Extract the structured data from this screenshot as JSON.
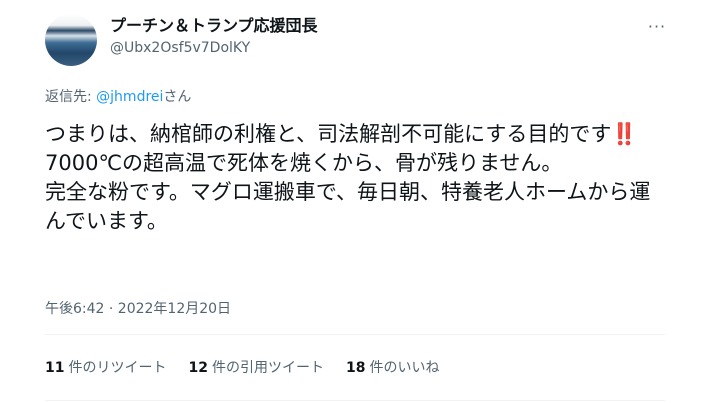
{
  "author": {
    "display_name": "プーチン＆トランプ応援団長",
    "handle": "@Ubx2Osf5v7DolKY",
    "avatar_icon": "profile-photo-icon"
  },
  "menu": {
    "more_icon": "more-options-icon",
    "more_glyph": "···"
  },
  "reply": {
    "prefix": "返信先: ",
    "mention": "@jhmdrei",
    "suffix": "さん"
  },
  "body": {
    "part1": "つまりは、納棺師の利権と、司法解剖不可能にする目的です",
    "emoji": "‼️",
    "part2": "\n7000℃の超高温で死体を焼くから、骨が残りません。\n完全な粉です。マグロ運搬車で、毎日朝、特養老人ホームから運んでいます。"
  },
  "timestamp": "午後6:42 · 2022年12月20日",
  "stats": [
    {
      "count": "11",
      "label": "件のリツイート"
    },
    {
      "count": "12",
      "label": "件の引用ツイート"
    },
    {
      "count": "18",
      "label": "件のいいね"
    }
  ],
  "colors": {
    "text": "#0f1419",
    "secondary": "#536471",
    "link": "#1d9bf0",
    "divider": "#eff3f4"
  }
}
